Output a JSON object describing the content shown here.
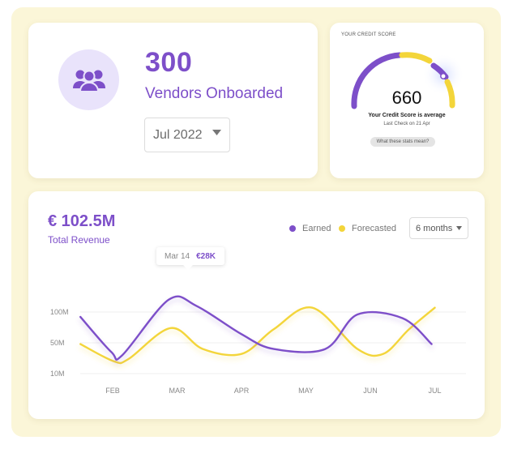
{
  "vendors": {
    "count": "300",
    "label": "Vendors Onboarded",
    "month_select": "Jul 2022",
    "icon": "users-icon"
  },
  "credit": {
    "title": "YOUR CREDIT SCORE",
    "score": "660",
    "status": "Your Credit Score is average",
    "last_check": "Last Check on 21 Apr",
    "button": "What these stats mean?",
    "colors": {
      "purple": "#7d4fc9",
      "yellow": "#f3d53a"
    }
  },
  "revenue": {
    "amount": "€ 102.5M",
    "label": "Total Revenue",
    "legend": [
      {
        "label": "Earned",
        "color": "#7d4fc9"
      },
      {
        "label": "Forecasted",
        "color": "#f3d53a"
      }
    ],
    "period_select": "6 months",
    "tooltip": {
      "date": "Mar 14",
      "value": "€28K"
    }
  },
  "chart_data": {
    "type": "line",
    "categories": [
      "FEB",
      "MAR",
      "APR",
      "MAY",
      "JUN",
      "JUL"
    ],
    "ytick_labels": [
      "100M",
      "50M",
      "10M"
    ],
    "series": [
      {
        "name": "Earned",
        "color": "#7d4fc9",
        "points": [
          [
            0.5,
            92
          ],
          [
            0.98,
            35
          ],
          [
            1.15,
            30
          ],
          [
            1.87,
            120
          ],
          [
            2.3,
            110
          ],
          [
            3.0,
            64
          ],
          [
            3.5,
            40
          ],
          [
            4.3,
            40
          ],
          [
            4.8,
            96
          ],
          [
            5.5,
            90
          ],
          [
            5.95,
            48
          ]
        ]
      },
      {
        "name": "Forecasted",
        "color": "#f3d53a",
        "points": [
          [
            0.5,
            48
          ],
          [
            1.02,
            20
          ],
          [
            1.25,
            24
          ],
          [
            1.9,
            74
          ],
          [
            2.4,
            40
          ],
          [
            3.0,
            32
          ],
          [
            3.5,
            72
          ],
          [
            4.1,
            107
          ],
          [
            4.8,
            40
          ],
          [
            5.2,
            32
          ],
          [
            5.6,
            72
          ],
          [
            6.0,
            107
          ]
        ]
      }
    ]
  }
}
